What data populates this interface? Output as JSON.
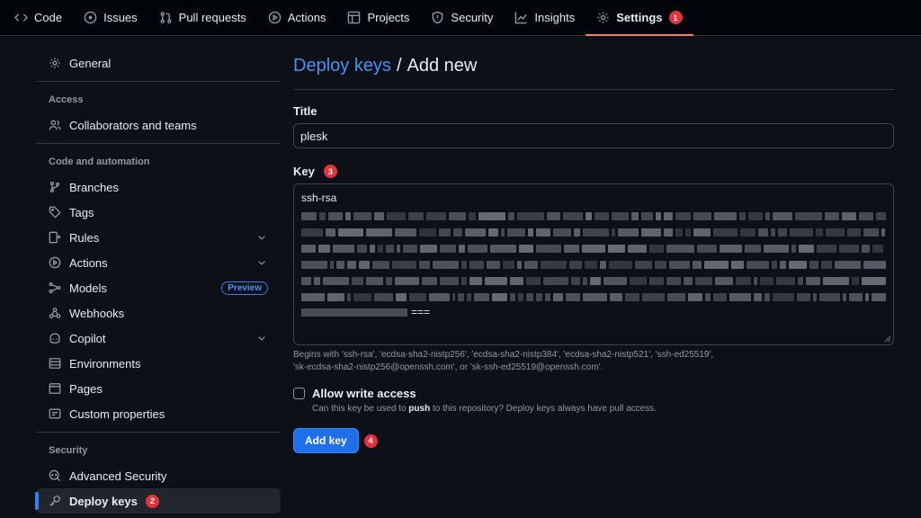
{
  "topnav": {
    "tabs": [
      {
        "label": "Code",
        "icon": "code-icon"
      },
      {
        "label": "Issues",
        "icon": "issue-icon"
      },
      {
        "label": "Pull requests",
        "icon": "pull-request-icon"
      },
      {
        "label": "Actions",
        "icon": "play-icon"
      },
      {
        "label": "Projects",
        "icon": "table-icon"
      },
      {
        "label": "Security",
        "icon": "shield-icon"
      },
      {
        "label": "Insights",
        "icon": "graph-icon"
      },
      {
        "label": "Settings",
        "icon": "gear-icon",
        "active": true,
        "marker": "1"
      }
    ]
  },
  "sidebar": {
    "general": "General",
    "access_title": "Access",
    "collaborators": "Collaborators and teams",
    "code_title": "Code and automation",
    "branches": "Branches",
    "tags": "Tags",
    "rules": "Rules",
    "actions": "Actions",
    "models": "Models",
    "preview_badge": "Preview",
    "webhooks": "Webhooks",
    "copilot": "Copilot",
    "environments": "Environments",
    "pages": "Pages",
    "custom_properties": "Custom properties",
    "security_title": "Security",
    "advanced_security": "Advanced Security",
    "deploy_keys": "Deploy keys",
    "deploy_keys_marker": "2"
  },
  "main": {
    "heading_link": "Deploy keys",
    "heading_sep": "/",
    "heading_rest": "Add new",
    "title_label": "Title",
    "title_value": "plesk",
    "key_label": "Key",
    "key_marker": "3",
    "key_value_prefix": "ssh-rsa",
    "key_value_end": "===",
    "hint_line1": "Begins with 'ssh-rsa', 'ecdsa-sha2-nistp256', 'ecdsa-sha2-nistp384', 'ecdsa-sha2-nistp521', 'ssh-ed25519',",
    "hint_line2": "'sk-ecdsa-sha2-nistp256@openssh.com', or 'sk-ssh-ed25519@openssh.com'.",
    "write_access_label": "Allow write access",
    "write_access_hint_pre": "Can this key be used to ",
    "write_access_hint_bold": "push",
    "write_access_hint_post": " to this repository? Deploy keys always have pull access.",
    "add_key_button": "Add key",
    "add_key_marker": "4"
  },
  "colors": {
    "accent": "#2f81f7",
    "link": "#4493f8",
    "button": "#1f6feb",
    "active_tab_underline": "#f78166",
    "marker": "#e5323c"
  }
}
